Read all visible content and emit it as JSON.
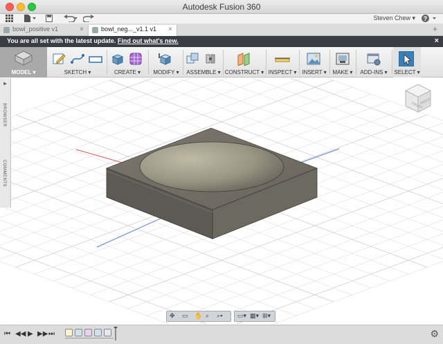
{
  "window": {
    "title": "Autodesk Fusion 360"
  },
  "quickaccess": {
    "user_name": "Steven Chew",
    "help_label": "?"
  },
  "tabs": [
    {
      "label": "bowl_positive v1",
      "active": false
    },
    {
      "label": "bowl_neg..._v1.1 v1",
      "active": true
    }
  ],
  "notification": {
    "message": "You are all set with the latest update.",
    "link_text": "Find out what's new.",
    "close_label": "×"
  },
  "toolbar": {
    "groups": [
      {
        "id": "model",
        "label": "MODEL ▾"
      },
      {
        "id": "sketch",
        "label": "SKETCH ▾"
      },
      {
        "id": "create",
        "label": "CREATE ▾"
      },
      {
        "id": "modify",
        "label": "MODIFY ▾"
      },
      {
        "id": "assemble",
        "label": "ASSEMBLE ▾"
      },
      {
        "id": "construct",
        "label": "CONSTRUCT ▾"
      },
      {
        "id": "inspect",
        "label": "INSPECT ▾"
      },
      {
        "id": "insert",
        "label": "INSERT ▾"
      },
      {
        "id": "make",
        "label": "MAKE ▾"
      },
      {
        "id": "addins",
        "label": "ADD-INS ▾"
      },
      {
        "id": "select",
        "label": "SELECT ▾"
      }
    ]
  },
  "sidepanel": {
    "browser_label": "BROWSER",
    "comments_label": "COMMENTS"
  },
  "viewcube": {
    "front_label": "FRONT",
    "right_label": "RIGHT"
  },
  "colors": {
    "toolbar_select_blue": "#3a80b8",
    "bowl_gray": "#6f6b63",
    "x_axis": "#e05050",
    "y_axis": "#5a7fd9"
  }
}
